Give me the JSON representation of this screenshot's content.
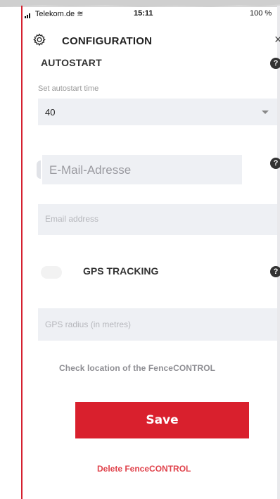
{
  "status_bar": {
    "carrier": "Telekom.de",
    "time": "15:11",
    "battery": "100 %"
  },
  "header": {
    "title": "CONFIGURATION",
    "icon": "gear-icon",
    "close_icon": "close-icon"
  },
  "autostart": {
    "section_title": "AUTOSTART",
    "field_label": "Set autostart time",
    "selected_value": "40"
  },
  "email": {
    "placeholder_de": "E-Mail-Adresse",
    "placeholder_en": "Email address"
  },
  "gps": {
    "title": "GPS TRACKING",
    "radius_placeholder": "GPS radius (in metres)"
  },
  "actions": {
    "check_location": "Check location of the FenceCONTROL",
    "save_label": "Save",
    "delete_label": "Delete FenceCONTROL"
  },
  "colors": {
    "accent": "#d9202d",
    "input_bg": "#eef0f4"
  }
}
